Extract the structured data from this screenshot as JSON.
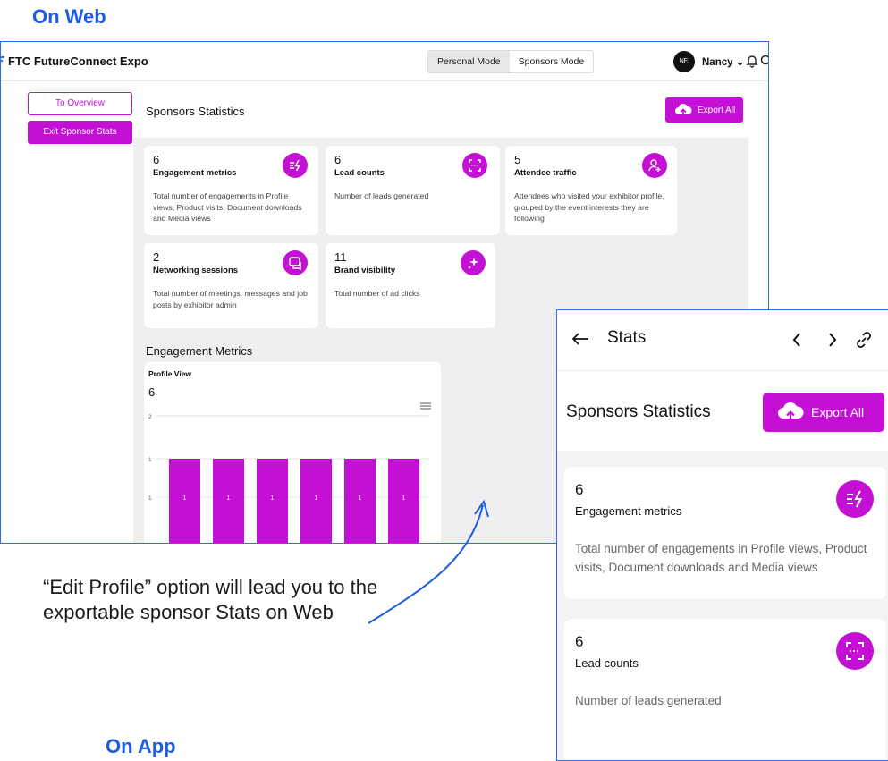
{
  "labels": {
    "web": "On Web",
    "app": "On App"
  },
  "annotation": {
    "line1": "“Edit Profile” option will lead you to the",
    "line2": "exportable sponsor Stats on Web"
  },
  "colors": {
    "accent": "#c40fd4",
    "frame": "#2f6fe0",
    "heading": "#1d5be0"
  },
  "web": {
    "brand": "FTC FutureConnect Expo",
    "modes": [
      "Personal Mode",
      "Sponsors Mode"
    ],
    "active_mode": "Personal Mode",
    "user": {
      "initials": "NF.",
      "name": "Nancy"
    },
    "sidebar": {
      "overview": "To Overview",
      "exit": "Exit Sponsor Stats"
    },
    "title": "Sponsors Statistics",
    "export": "Export All",
    "stats": [
      {
        "value": "6",
        "title": "Engagement metrics",
        "desc": "Total number of engagements in Profile views, Product visits, Document downloads and Media views",
        "icon": "engagement-icon"
      },
      {
        "value": "6",
        "title": "Lead counts",
        "desc": "Number of leads generated",
        "icon": "scan-icon"
      },
      {
        "value": "5",
        "title": "Attendee traffic",
        "desc": "Attendees who visited your exhibitor profile, grouped by the event interests they are following",
        "icon": "user-add-icon"
      },
      {
        "value": "2",
        "title": "Networking sessions",
        "desc": "Total number of meetings, messages and job posts by exhibitor admin",
        "icon": "chat-icon"
      },
      {
        "value": "11",
        "title": "Brand visibility",
        "desc": "Total number of ad clicks",
        "icon": "sparkle-icon"
      }
    ],
    "engagement_heading": "Engagement Metrics"
  },
  "chart_data": {
    "type": "bar",
    "title": "Profile View",
    "total": "6",
    "categories": [
      "",
      "",
      "",
      "",
      "",
      ""
    ],
    "values": [
      1,
      1,
      1,
      1,
      1,
      1
    ],
    "yticks": [
      "2",
      "1",
      "1"
    ],
    "color": "#c40fd4"
  },
  "app": {
    "title": "Stats",
    "subtitle": "Sponsors Statistics",
    "export": "Export All",
    "cards": [
      {
        "value": "6",
        "title": "Engagement metrics",
        "desc": "Total number of engagements in Profile views, Product visits, Document downloads and Media views"
      },
      {
        "value": "6",
        "title": "Lead counts",
        "desc": "Number of leads generated"
      }
    ]
  }
}
